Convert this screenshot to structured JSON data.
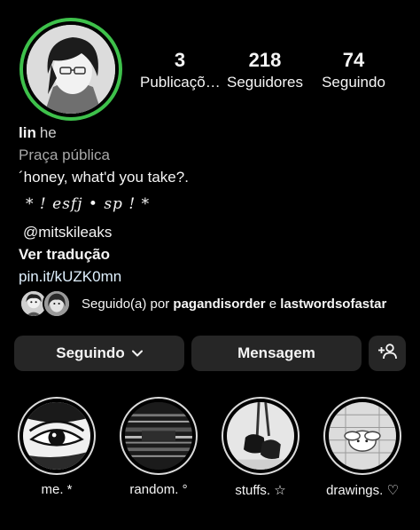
{
  "profile": {
    "name": "lin",
    "pronoun": "he",
    "category": "Praça pública",
    "bio_line": "´honey, what'd you take?.",
    "fancy_line": "* ! esfj • sp ! *",
    "mention": "@mitskileaks",
    "translate": "Ver tradução",
    "link": "pin.it/kUZK0mn"
  },
  "stats": [
    {
      "value": "3",
      "label": "Publicaçõ…"
    },
    {
      "value": "218",
      "label": "Seguidores"
    },
    {
      "value": "74",
      "label": "Seguindo"
    }
  ],
  "followed_by": {
    "prefix": "Seguido(a) por",
    "user1": "pagandisorder",
    "conjunction": "e",
    "user2": "lastwordsofastar"
  },
  "buttons": {
    "following": "Seguindo",
    "message": "Mensagem"
  },
  "highlights": [
    {
      "label": "me. *"
    },
    {
      "label": "random. °"
    },
    {
      "label": "stuffs. ☆"
    },
    {
      "label": "drawings. ♡"
    }
  ],
  "colors": {
    "story_ring": "#3ec14b",
    "button_bg": "#262626",
    "background": "#000000"
  },
  "icons": {
    "chevron": "chevron-down-icon",
    "add_user": "add-user-icon"
  }
}
